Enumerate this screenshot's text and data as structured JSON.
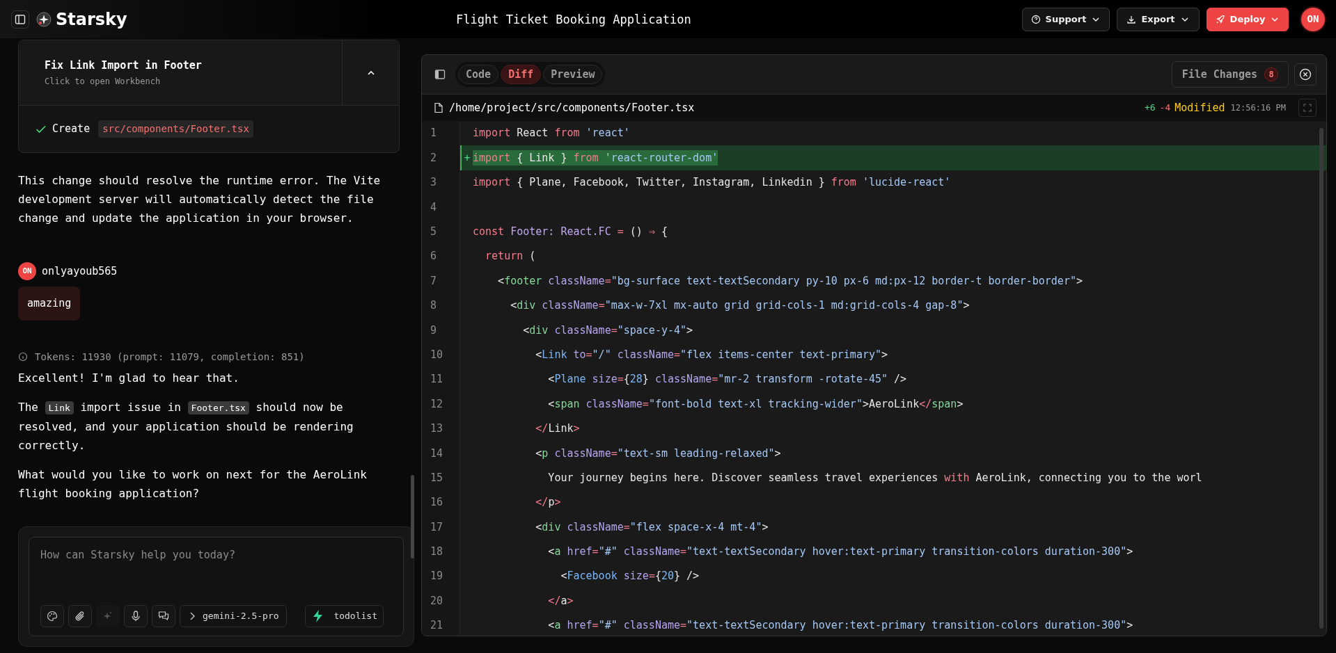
{
  "header": {
    "app_name": "Starsky",
    "title": "Flight Ticket Booking Application",
    "buttons": [
      {
        "label": "Support",
        "kind": "support"
      },
      {
        "label": "Export",
        "kind": "export"
      },
      {
        "label": "Deploy",
        "kind": "deploy"
      }
    ],
    "avatar": "ON"
  },
  "chat": {
    "task_card": {
      "title": "Fix Link Import in Footer",
      "subtitle": "Click to open Workbench",
      "expanded": true,
      "actions": [
        {
          "verb": "Create",
          "path": "src/components/Footer.tsx",
          "done": true
        }
      ]
    },
    "messages": [
      {
        "kind": "reply",
        "paragraphs": [
          [
            {
              "kind": "text",
              "text": "This change should resolve the runtime error. The Vite development server will automatically detect the file change and update the application in your browser."
            }
          ]
        ]
      },
      {
        "kind": "prompt",
        "author": "onlyayoub565",
        "avatar": "ON",
        "text": "amazing"
      },
      {
        "kind": "reply",
        "tokens_info": "Tokens: 11930 (prompt: 11079, completion: 851)",
        "paragraphs": [
          [
            {
              "kind": "text",
              "text": "Excellent! I'm glad to hear that."
            }
          ],
          [
            {
              "kind": "text",
              "text": "The "
            },
            {
              "kind": "code",
              "text": "Link"
            },
            {
              "kind": "text",
              "text": " import issue in "
            },
            {
              "kind": "code",
              "text": "Footer.tsx"
            },
            {
              "kind": "text",
              "text": " should now be resolved, and your application should be rendering correctly."
            }
          ],
          [
            {
              "kind": "text",
              "text": "What would you like to work on next for the AeroLink flight booking application?"
            }
          ]
        ]
      }
    ],
    "composer": {
      "placeholder": "How can Starsky help you today?",
      "model": "gemini-2.5-pro",
      "project": "todolist"
    }
  },
  "workbench": {
    "views": [
      {
        "label": "Code",
        "selected": false
      },
      {
        "label": "Diff",
        "selected": true
      },
      {
        "label": "Preview",
        "selected": false
      }
    ],
    "file_changes": {
      "label": "File Changes",
      "count": "8"
    },
    "file": {
      "path": "/home/project/src/components/Footer.tsx",
      "added": "+6",
      "removed": "-4",
      "status": "Modified",
      "time": "12:56:16 PM"
    },
    "lines": [
      {
        "number": "1",
        "added": false,
        "tokens": [
          {
            "kind": "kw",
            "text": "import"
          },
          {
            "kind": "txt",
            "text": " React "
          },
          {
            "kind": "kw",
            "text": "from"
          },
          {
            "kind": "str",
            "text": " 'react'"
          }
        ]
      },
      {
        "number": "2",
        "added": true,
        "marker": "+",
        "tokens": [
          {
            "kind": "kw",
            "text": "import"
          },
          {
            "kind": "txt",
            "text": " { Link } "
          },
          {
            "kind": "kw",
            "text": "from"
          },
          {
            "kind": "str",
            "text": " 'react-router-dom'"
          }
        ]
      },
      {
        "number": "3",
        "added": false,
        "tokens": [
          {
            "kind": "kw",
            "text": "import"
          },
          {
            "kind": "txt",
            "text": " { Plane, Facebook, Twitter, Instagram, Linkedin } "
          },
          {
            "kind": "kw",
            "text": "from"
          },
          {
            "kind": "str",
            "text": " 'lucide-react'"
          }
        ]
      },
      {
        "number": "4",
        "added": false
      },
      {
        "number": "5",
        "added": false,
        "tokens": [
          {
            "kind": "kw",
            "text": "const"
          },
          {
            "kind": "type",
            "text": " Footer: React.FC "
          },
          {
            "kind": "op",
            "text": "="
          },
          {
            "kind": "txt",
            "text": " () "
          },
          {
            "kind": "op",
            "text": "⇒"
          },
          {
            "kind": "txt",
            "text": " {"
          }
        ]
      },
      {
        "number": "6",
        "added": false,
        "tokens": [
          {
            "kind": "kw",
            "text": "  return"
          },
          {
            "kind": "txt",
            "text": " ("
          }
        ]
      },
      {
        "number": "7",
        "added": false,
        "tokens": [
          {
            "kind": "txt",
            "text": "    <"
          },
          {
            "kind": "tag",
            "text": "footer"
          },
          {
            "kind": "attr",
            "text": " className"
          },
          {
            "kind": "op",
            "text": "="
          },
          {
            "kind": "str",
            "text": "\"bg-surface text-textSecondary py-10 px-6 md:px-12 border-t border-border\""
          },
          {
            "kind": "txt",
            "text": ">"
          }
        ]
      },
      {
        "number": "8",
        "added": false,
        "tokens": [
          {
            "kind": "txt",
            "text": "      <"
          },
          {
            "kind": "tag",
            "text": "div"
          },
          {
            "kind": "attr",
            "text": " className"
          },
          {
            "kind": "op",
            "text": "="
          },
          {
            "kind": "str",
            "text": "\"max-w-7xl mx-auto grid grid-cols-1 md:grid-cols-4 gap-8\""
          },
          {
            "kind": "txt",
            "text": ">"
          }
        ]
      },
      {
        "number": "9",
        "added": false,
        "tokens": [
          {
            "kind": "txt",
            "text": "        <"
          },
          {
            "kind": "tag",
            "text": "div"
          },
          {
            "kind": "attr",
            "text": " className"
          },
          {
            "kind": "op",
            "text": "="
          },
          {
            "kind": "str",
            "text": "\"space-y-4\""
          },
          {
            "kind": "txt",
            "text": ">"
          }
        ]
      },
      {
        "number": "10",
        "added": false,
        "tokens": [
          {
            "kind": "txt",
            "text": "          <"
          },
          {
            "kind": "comp",
            "text": "Link"
          },
          {
            "kind": "attr",
            "text": " to"
          },
          {
            "kind": "op",
            "text": "="
          },
          {
            "kind": "str",
            "text": "\"/\""
          },
          {
            "kind": "attr",
            "text": " className"
          },
          {
            "kind": "op",
            "text": "="
          },
          {
            "kind": "str",
            "text": "\"flex items-center text-primary\""
          },
          {
            "kind": "txt",
            "text": ">"
          }
        ]
      },
      {
        "number": "11",
        "added": false,
        "tokens": [
          {
            "kind": "txt",
            "text": "            <"
          },
          {
            "kind": "comp",
            "text": "Plane"
          },
          {
            "kind": "attr",
            "text": " size"
          },
          {
            "kind": "op",
            "text": "="
          },
          {
            "kind": "txt",
            "text": "{"
          },
          {
            "kind": "num",
            "text": "28"
          },
          {
            "kind": "txt",
            "text": "}"
          },
          {
            "kind": "attr",
            "text": " className"
          },
          {
            "kind": "op",
            "text": "="
          },
          {
            "kind": "str",
            "text": "\"mr-2 transform -rotate-45\""
          },
          {
            "kind": "txt",
            "text": " />"
          }
        ]
      },
      {
        "number": "12",
        "added": false,
        "tokens": [
          {
            "kind": "txt",
            "text": "            <"
          },
          {
            "kind": "tag",
            "text": "span"
          },
          {
            "kind": "attr",
            "text": " className"
          },
          {
            "kind": "op",
            "text": "="
          },
          {
            "kind": "str",
            "text": "\"font-bold text-xl tracking-wider\""
          },
          {
            "kind": "txt",
            "text": ">AeroLink"
          },
          {
            "kind": "op",
            "text": "</"
          },
          {
            "kind": "tag",
            "text": "span"
          },
          {
            "kind": "txt",
            "text": ">"
          }
        ]
      },
      {
        "number": "13",
        "added": false,
        "tokens": [
          {
            "kind": "op",
            "text": "          </"
          },
          {
            "kind": "txt",
            "text": "Link"
          },
          {
            "kind": "op",
            "text": ">"
          }
        ]
      },
      {
        "number": "14",
        "added": false,
        "tokens": [
          {
            "kind": "txt",
            "text": "          <"
          },
          {
            "kind": "tag",
            "text": "p"
          },
          {
            "kind": "attr",
            "text": " className"
          },
          {
            "kind": "op",
            "text": "="
          },
          {
            "kind": "str",
            "text": "\"text-sm leading-relaxed\""
          },
          {
            "kind": "txt",
            "text": ">"
          }
        ]
      },
      {
        "number": "15",
        "added": false,
        "tokens": [
          {
            "kind": "txt",
            "text": "            Your journey begins here. Discover seamless travel experiences "
          },
          {
            "kind": "kw",
            "text": "with"
          },
          {
            "kind": "txt",
            "text": " AeroLink, connecting you to the worl"
          }
        ]
      },
      {
        "number": "16",
        "added": false,
        "tokens": [
          {
            "kind": "op",
            "text": "          </"
          },
          {
            "kind": "txt",
            "text": "p"
          },
          {
            "kind": "op",
            "text": ">"
          }
        ]
      },
      {
        "number": "17",
        "added": false,
        "tokens": [
          {
            "kind": "txt",
            "text": "          <"
          },
          {
            "kind": "tag",
            "text": "div"
          },
          {
            "kind": "attr",
            "text": " className"
          },
          {
            "kind": "op",
            "text": "="
          },
          {
            "kind": "str",
            "text": "\"flex space-x-4 mt-4\""
          },
          {
            "kind": "txt",
            "text": ">"
          }
        ]
      },
      {
        "number": "18",
        "added": false,
        "tokens": [
          {
            "kind": "txt",
            "text": "            <"
          },
          {
            "kind": "tag",
            "text": "a"
          },
          {
            "kind": "attr",
            "text": " href"
          },
          {
            "kind": "op",
            "text": "="
          },
          {
            "kind": "str",
            "text": "\"#\""
          },
          {
            "kind": "attr",
            "text": " className"
          },
          {
            "kind": "op",
            "text": "="
          },
          {
            "kind": "str",
            "text": "\"text-textSecondary hover:text-primary transition-colors duration-300\""
          },
          {
            "kind": "txt",
            "text": ">"
          }
        ]
      },
      {
        "number": "19",
        "added": false,
        "tokens": [
          {
            "kind": "txt",
            "text": "              <"
          },
          {
            "kind": "comp",
            "text": "Facebook"
          },
          {
            "kind": "attr",
            "text": " size"
          },
          {
            "kind": "op",
            "text": "="
          },
          {
            "kind": "txt",
            "text": "{"
          },
          {
            "kind": "num",
            "text": "20"
          },
          {
            "kind": "txt",
            "text": "} />"
          }
        ]
      },
      {
        "number": "20",
        "added": false,
        "tokens": [
          {
            "kind": "op",
            "text": "            </"
          },
          {
            "kind": "txt",
            "text": "a"
          },
          {
            "kind": "op",
            "text": ">"
          }
        ]
      },
      {
        "number": "21",
        "added": false,
        "tokens": [
          {
            "kind": "txt",
            "text": "            <"
          },
          {
            "kind": "tag",
            "text": "a"
          },
          {
            "kind": "attr",
            "text": " href"
          },
          {
            "kind": "op",
            "text": "="
          },
          {
            "kind": "str",
            "text": "\"#\""
          },
          {
            "kind": "attr",
            "text": " className"
          },
          {
            "kind": "op",
            "text": "="
          },
          {
            "kind": "str",
            "text": "\"text-textSecondary hover:text-primary transition-colors duration-300\""
          },
          {
            "kind": "txt",
            "text": ">"
          }
        ]
      }
    ]
  }
}
